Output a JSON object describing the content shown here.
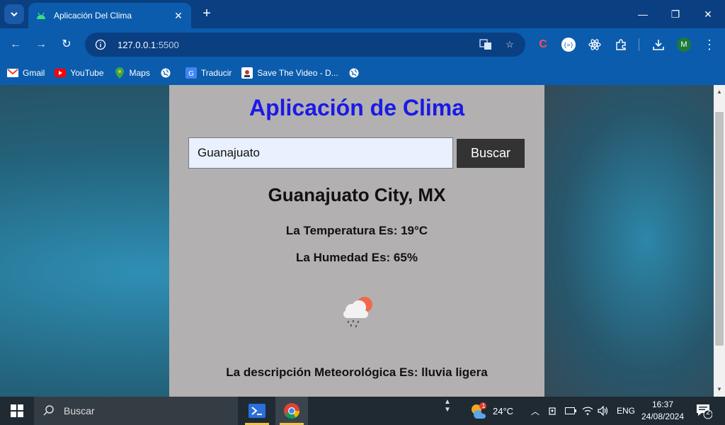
{
  "browser": {
    "tab": {
      "title": "Aplicación Del Clima"
    },
    "url": {
      "host": "127.0.0.1",
      "port": ":5500"
    },
    "profile_initial": "M",
    "bookmarks": [
      {
        "label": "Gmail",
        "icon": "gmail-icon"
      },
      {
        "label": "YouTube",
        "icon": "youtube-icon"
      },
      {
        "label": "Maps",
        "icon": "maps-icon"
      },
      {
        "label": "",
        "icon": "globe-icon"
      },
      {
        "label": "Traducir",
        "icon": "translate-icon"
      },
      {
        "label": "Save The Video - D...",
        "icon": "save-video-icon"
      },
      {
        "label": "",
        "icon": "globe-icon"
      }
    ]
  },
  "app": {
    "title": "Aplicación de Clima",
    "search": {
      "value": "Guanajuato",
      "button_label": "Buscar"
    },
    "city": "Guanajuato City, MX",
    "temperature": "La Temperatura Es: 19°C",
    "humidity": "La Humedad Es: 65%",
    "weather_icon": "light-rain-cloud-sun-icon",
    "description": "La descripción Meteorológica Es: lluvia ligera"
  },
  "taskbar": {
    "search_placeholder": "Buscar",
    "weather": {
      "temp": "24°C",
      "badge": "1"
    },
    "language": "ENG",
    "time": "16:37",
    "date": "24/08/2024",
    "notifications": "2"
  },
  "colors": {
    "chrome_dark": "#0a3f82",
    "chrome": "#0b5cad",
    "panel": "#b3b0b1",
    "title_blue": "#1a1ae6",
    "button_dark": "#333333"
  }
}
